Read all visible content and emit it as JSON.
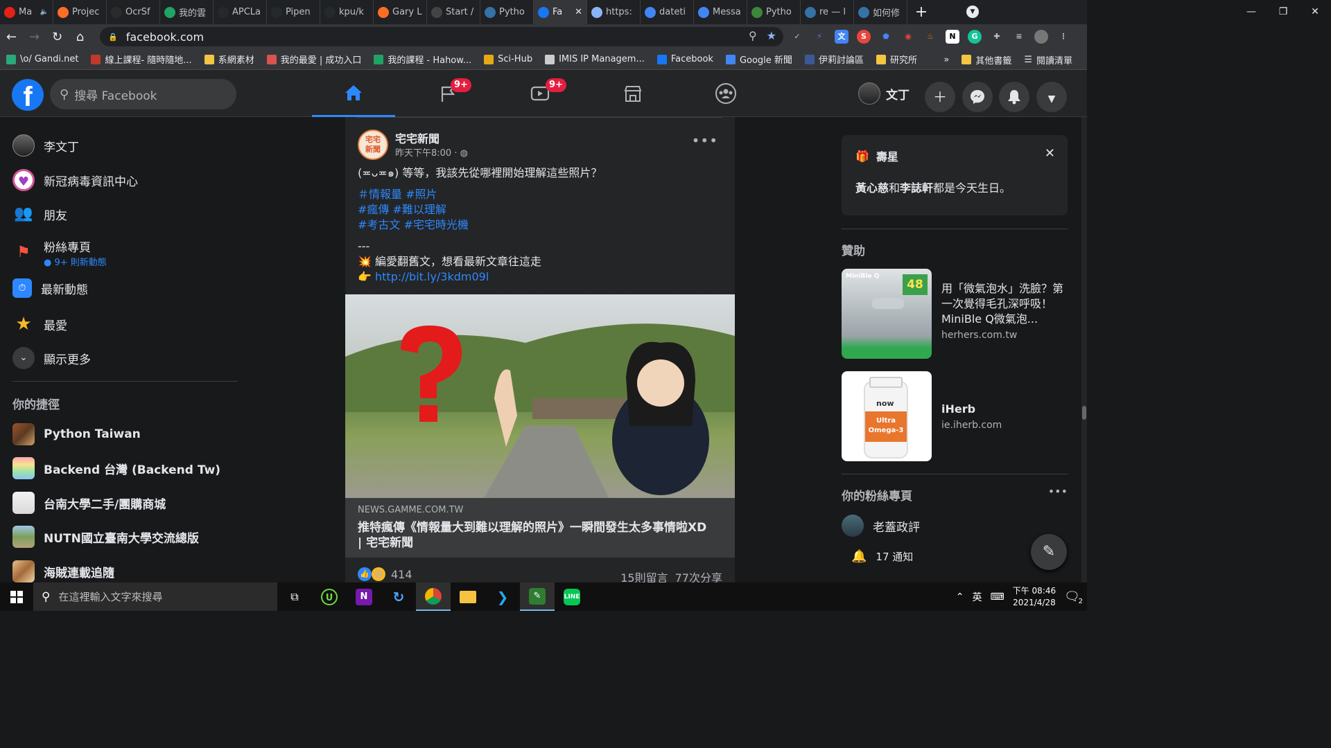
{
  "browser": {
    "tabs": [
      {
        "title": "Ma",
        "color": "#e62117",
        "muted": true
      },
      {
        "title": "Projec",
        "color": "#fc6d26"
      },
      {
        "title": "OcrSf",
        "color": "#2b2b2b"
      },
      {
        "title": "我的雲",
        "color": "#1fa463"
      },
      {
        "title": "APCLa",
        "color": "#24292e"
      },
      {
        "title": "Pipen",
        "color": "#24292e"
      },
      {
        "title": "kpu/k",
        "color": "#24292e"
      },
      {
        "title": "Gary L",
        "color": "#fc6d26"
      },
      {
        "title": "Start /",
        "color": "#444444"
      },
      {
        "title": "Pytho",
        "color": "#3572a5"
      },
      {
        "title": "Fa",
        "color": "#1877f2",
        "active": true
      },
      {
        "title": "https:",
        "color": "#8ab4f8"
      },
      {
        "title": "dateti",
        "color": "#4285f4"
      },
      {
        "title": "Messa",
        "color": "#4285f4"
      },
      {
        "title": "Pytho",
        "color": "#3c873a"
      },
      {
        "title": "re — l",
        "color": "#3572a5"
      },
      {
        "title": "如何修",
        "color": "#3572a5"
      }
    ],
    "url": "facebook.com",
    "bookmarks": [
      {
        "label": "\\o/ Gandi.net",
        "color": "#2aa87b"
      },
      {
        "label": "線上課程- 隨時隨地...",
        "color": "#c0392b"
      },
      {
        "label": "系網素材",
        "color": "#f4c542"
      },
      {
        "label": "我的最愛 | 成功入口",
        "color": "#d9534f"
      },
      {
        "label": "我的課程 - Hahow...",
        "color": "#21a366"
      },
      {
        "label": "Sci-Hub",
        "color": "#e6a817"
      },
      {
        "label": "IMIS IP Managem...",
        "color": "#cccccc"
      },
      {
        "label": "Facebook",
        "color": "#1877f2"
      },
      {
        "label": "Google 新聞",
        "color": "#4285f4"
      },
      {
        "label": "伊莉討論區",
        "color": "#3b5998"
      },
      {
        "label": "研究所",
        "color": "#f4c542"
      }
    ],
    "bookmarks_more": "»",
    "other_bookmarks": "其他書籤",
    "reading_list": "閱讀清單",
    "window_controls": [
      "—",
      "❐",
      "✕"
    ]
  },
  "fb": {
    "search_placeholder": "搜尋 Facebook",
    "nav_badges": {
      "pages": "9+",
      "watch": "9+"
    },
    "user_short": "文丁"
  },
  "left": {
    "items": [
      {
        "label": "李文丁"
      },
      {
        "label": "新冠病毒資訊中心"
      },
      {
        "label": "朋友"
      },
      {
        "label": "粉絲專頁",
        "sub": "9+ 則新動態"
      },
      {
        "label": "最新動態"
      },
      {
        "label": "最愛"
      },
      {
        "label": "顯示更多"
      }
    ],
    "shortcuts_title": "你的捷徑",
    "shortcuts": [
      {
        "label": "Python Taiwan"
      },
      {
        "label": "Backend 台灣 (Backend Tw)"
      },
      {
        "label": "台南大學二手/團購商城"
      },
      {
        "label": "NUTN國立臺南大學交流總版"
      },
      {
        "label": "海賊連載追隨"
      }
    ]
  },
  "post": {
    "author": "宅宅新聞",
    "avatar_text": "宅宅新聞",
    "time": "昨天下午8:00 ·",
    "text": "(≖ᴗ≖๑) 等等，我該先從哪裡開始理解這些照片？",
    "tags": [
      "＃情報量 #照片",
      "#瘋傳 #難以理解",
      "#考古文 #宅宅時光機"
    ],
    "separator": "---",
    "line1": "編愛翻舊文，想看最新文章往這走",
    "link": "http://bit.ly/3kdm09l",
    "image_symbol": "?",
    "card_domain": "NEWS.GAMME.COM.TW",
    "card_title": "推特瘋傳《情報量大到難以理解的照片》一瞬間發生太多事情啦XD | 宅宅新聞",
    "reactions": "414",
    "comments": "15則留言",
    "shares": "77次分享"
  },
  "right": {
    "birthday_title": "壽星",
    "birthday_names": [
      "黃心慈",
      "李誌軒"
    ],
    "birthday_and": "和",
    "birthday_text": "都是今天生日。",
    "sponsored": "贊助",
    "ads": [
      {
        "title": "用「微氣泡水」洗臉？第一次覺得毛孔深呼吸！MiniBle Q微氣泡...",
        "domain": "herhers.com.tw",
        "img_badge": "48",
        "img_brand": "MiniBle Q"
      },
      {
        "title": "iHerb",
        "domain": "ie.iherb.com",
        "img_label": "Ultra Omega-3",
        "img_brand": "now"
      }
    ],
    "pages_title": "你的粉絲專頁",
    "page_name": "老蓋政評",
    "notifications": "17 通知"
  },
  "taskbar": {
    "search_placeholder": "在這裡輸入文字來搜尋",
    "ime": "英",
    "time": "下午 08:46",
    "date": "2021/4/28",
    "notif_count": "2"
  }
}
